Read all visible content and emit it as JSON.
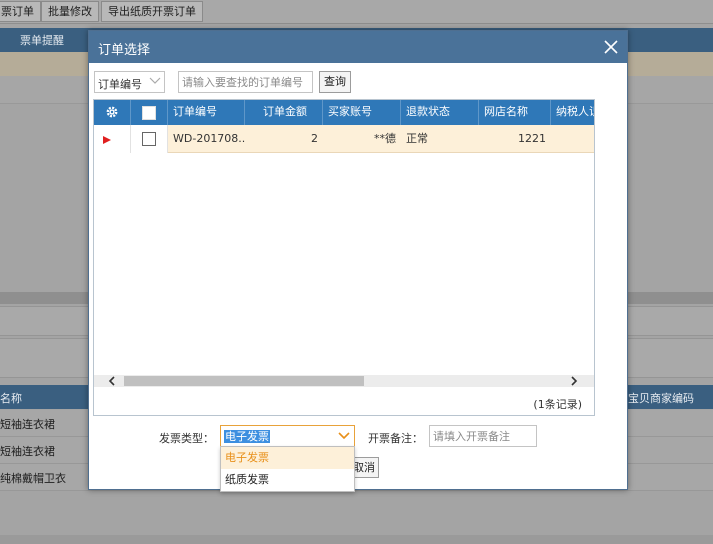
{
  "background": {
    "toolbar_buttons": [
      "票订单",
      "批量修改",
      "导出纸质开票订单"
    ],
    "table_header": [
      "票单提醒"
    ],
    "product_header": [
      "名称",
      "宝贝商家编码"
    ],
    "products": [
      "短袖连衣裙",
      "短袖连衣裙",
      "纯棉戴帽卫衣"
    ]
  },
  "dialog": {
    "title": "订单选择",
    "search": {
      "field_value": "订单编号",
      "placeholder": "请输入要查找的订单编号",
      "query_label": "查询"
    },
    "grid": {
      "columns": [
        "订单编号",
        "订单金额",
        "买家账号",
        "退款状态",
        "网店名称",
        "纳税人识"
      ],
      "rows": [
        {
          "order_no": "WD-201708...",
          "amount": "2",
          "buyer": "**德",
          "refund": "正常",
          "shop": "1221",
          "tax": ""
        }
      ],
      "records": "(1条记录)"
    },
    "form": {
      "invoice_type_label": "发票类型：",
      "invoice_type_value": "电子发票",
      "remark_label": "开票备注：",
      "remark_placeholder": "请填入开票备注"
    },
    "cancel_label": "取消",
    "dropdown_options": [
      "电子发票",
      "纸质发票"
    ]
  },
  "colors": {
    "header_blue": "#2f78b8",
    "title_bar": "#4a7299",
    "selected_row": "#fdf0d9",
    "dropdown_highlight": "#e8901a"
  }
}
